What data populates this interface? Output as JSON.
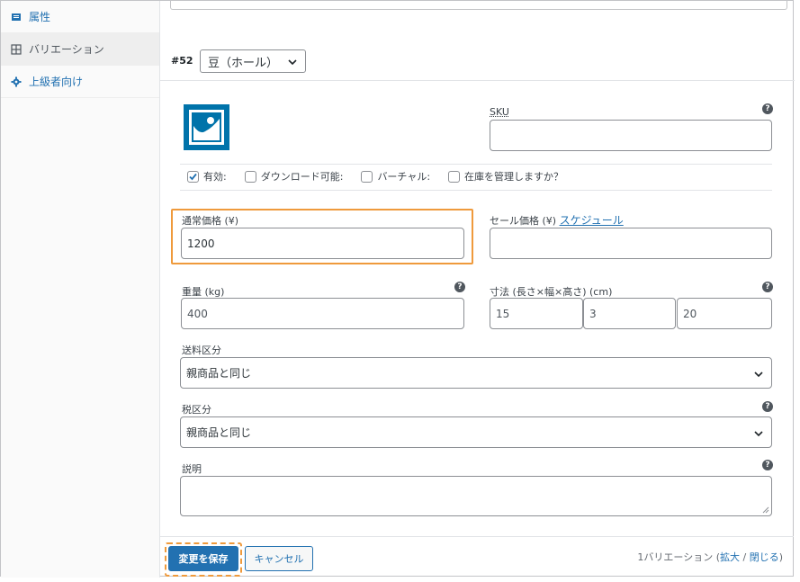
{
  "sidebar": {
    "items": [
      {
        "label": "属性",
        "icon": "list-icon",
        "active": false
      },
      {
        "label": "バリエーション",
        "icon": "grid-icon",
        "active": true
      },
      {
        "label": "上級者向け",
        "icon": "gear-icon",
        "active": false
      }
    ]
  },
  "variation": {
    "id": "#52",
    "selected": "豆（ホール）"
  },
  "fields": {
    "sku_label": "SKU",
    "checkboxes": [
      {
        "label": "有効:",
        "checked": true
      },
      {
        "label": "ダウンロード可能:",
        "checked": false
      },
      {
        "label": "バーチャル:",
        "checked": false
      },
      {
        "label": "在庫を管理しますか？",
        "checked": false
      }
    ],
    "regular_price_label": "通常価格 (¥)",
    "regular_price_value": "1200",
    "sale_price_label": "セール価格 (¥)",
    "schedule_link": "スケジュール",
    "weight_label": "重量 (kg)",
    "weight_value": "400",
    "dimensions_label": "寸法 (長さ×幅×高さ) (cm)",
    "length_value": "15",
    "width_value": "3",
    "height_value": "20",
    "shipping_class_label": "送料区分",
    "shipping_class_value": "親商品と同じ",
    "tax_class_label": "税区分",
    "tax_class_value": "親商品と同じ",
    "description_label": "説明"
  },
  "footer": {
    "save_label": "変更を保存",
    "cancel_label": "キャンセル",
    "count_text": "1バリエーション (",
    "expand_link": "拡大",
    "divider": " / ",
    "close_link": "閉じる",
    "close_paren": ")"
  },
  "colors": {
    "accent": "#2271b1",
    "highlight": "#ef9a3c"
  }
}
